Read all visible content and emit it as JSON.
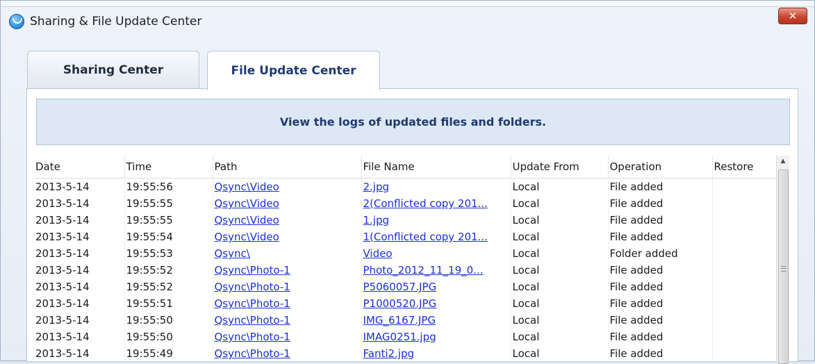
{
  "window": {
    "title": "Sharing & File Update Center",
    "close_glyph": "✕"
  },
  "tabs": [
    {
      "label": "Sharing Center",
      "active": false
    },
    {
      "label": "File Update Center",
      "active": true
    }
  ],
  "banner": {
    "text": "View the logs of updated files and folders."
  },
  "table": {
    "columns": [
      "Date",
      "Time",
      "Path",
      "File Name",
      "Update From",
      "Operation",
      "Restore"
    ],
    "rows": [
      {
        "date": "2013-5-14",
        "time": "19:55:56",
        "path": "Qsync\\Video",
        "file": "2.jpg",
        "from": "Local",
        "op": "File added",
        "restore": ""
      },
      {
        "date": "2013-5-14",
        "time": "19:55:55",
        "path": "Qsync\\Video",
        "file": "2(Conflicted copy 201...",
        "from": "Local",
        "op": "File added",
        "restore": ""
      },
      {
        "date": "2013-5-14",
        "time": "19:55:55",
        "path": "Qsync\\Video",
        "file": "1.jpg",
        "from": "Local",
        "op": "File added",
        "restore": ""
      },
      {
        "date": "2013-5-14",
        "time": "19:55:54",
        "path": "Qsync\\Video",
        "file": "1(Conflicted copy 201...",
        "from": "Local",
        "op": "File added",
        "restore": ""
      },
      {
        "date": "2013-5-14",
        "time": "19:55:53",
        "path": "Qsync\\",
        "file": "Video",
        "from": "Local",
        "op": "Folder added",
        "restore": ""
      },
      {
        "date": "2013-5-14",
        "time": "19:55:52",
        "path": "Qsync\\Photo-1",
        "file": "Photo_2012_11_19_0...",
        "from": "Local",
        "op": "File added",
        "restore": ""
      },
      {
        "date": "2013-5-14",
        "time": "19:55:52",
        "path": "Qsync\\Photo-1",
        "file": "P5060057.JPG",
        "from": "Local",
        "op": "File added",
        "restore": ""
      },
      {
        "date": "2013-5-14",
        "time": "19:55:51",
        "path": "Qsync\\Photo-1",
        "file": "P1000520.JPG",
        "from": "Local",
        "op": "File added",
        "restore": ""
      },
      {
        "date": "2013-5-14",
        "time": "19:55:50",
        "path": "Qsync\\Photo-1",
        "file": "IMG_6167.JPG",
        "from": "Local",
        "op": "File added",
        "restore": ""
      },
      {
        "date": "2013-5-14",
        "time": "19:55:50",
        "path": "Qsync\\Photo-1",
        "file": "IMAG0251.jpg",
        "from": "Local",
        "op": "File added",
        "restore": ""
      },
      {
        "date": "2013-5-14",
        "time": "19:55:49",
        "path": "Qsync\\Photo-1",
        "file": "Fanti2.jpg",
        "from": "Local",
        "op": "File added",
        "restore": ""
      }
    ]
  },
  "scrollbar": {
    "up_glyph": "▲"
  }
}
